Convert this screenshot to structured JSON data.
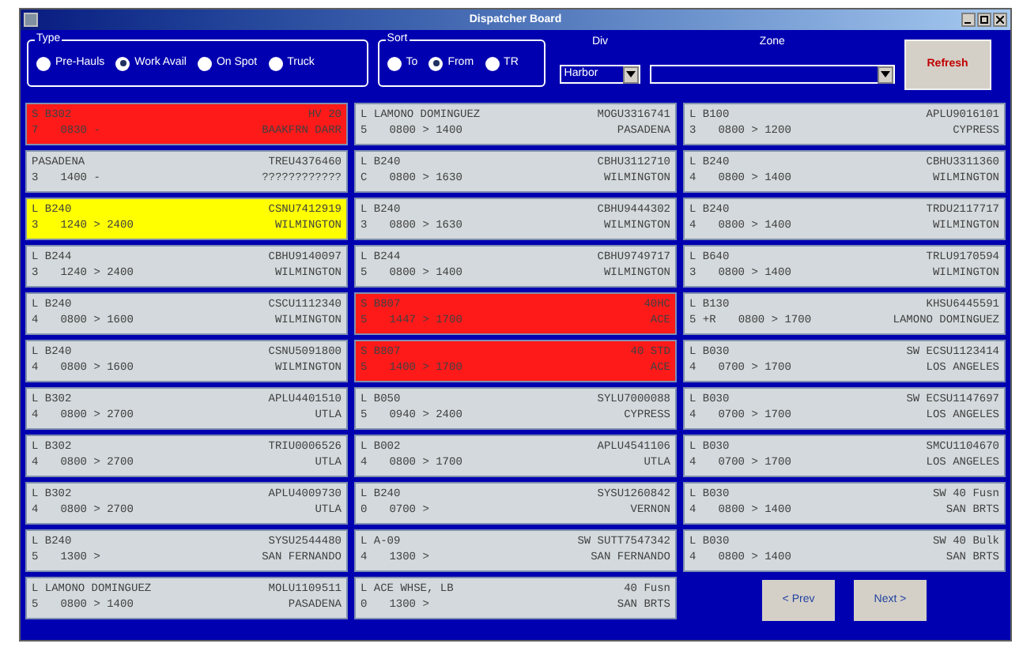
{
  "window": {
    "title": "Dispatcher Board"
  },
  "type_group": {
    "legend": "Type",
    "options": [
      {
        "label": "Pre-Hauls",
        "selected": false
      },
      {
        "label": "Work Avail",
        "selected": true
      },
      {
        "label": "On Spot",
        "selected": false
      },
      {
        "label": "Truck",
        "selected": false
      }
    ]
  },
  "sort_group": {
    "legend": "Sort",
    "options": [
      {
        "label": "To",
        "selected": false
      },
      {
        "label": "From",
        "selected": true
      },
      {
        "label": "TR",
        "selected": false
      }
    ]
  },
  "div": {
    "label": "Div",
    "value": "Harbor"
  },
  "zone": {
    "label": "Zone"
  },
  "refresh_button": "Refresh",
  "columns": [
    {
      "cards": [
        {
          "color": "#ff1a1a",
          "yard": "S B302",
          "container": "HV 20",
          "slot": "7",
          "window": "0830 -",
          "location": "BAAKFRN DARR"
        },
        {
          "color": "#d3d9dc",
          "yard": "PASADENA",
          "container": "TREU4376460",
          "slot": "3",
          "window": "1400 -",
          "location": "????????????"
        },
        {
          "color": "#ffff00",
          "yard": "L B240",
          "container": "CSNU7412919",
          "slot": "3",
          "window": "1240 > 2400",
          "location": "WILMINGTON"
        },
        {
          "color": "#d3d9dc",
          "yard": "L B244",
          "container": "CBHU9140097",
          "slot": "3",
          "window": "1240 > 2400",
          "location": "WILMINGTON"
        },
        {
          "color": "#d3d9dc",
          "yard": "L B240",
          "container": "CSCU1112340",
          "slot": "4",
          "window": "0800 > 1600",
          "location": "WILMINGTON"
        },
        {
          "color": "#d3d9dc",
          "yard": "L B240",
          "container": "CSNU5091800",
          "slot": "4",
          "window": "0800 > 1600",
          "location": "WILMINGTON"
        },
        {
          "color": "#d3d9dc",
          "yard": "L B302",
          "container": "APLU4401510",
          "slot": "4",
          "window": "0800 > 2700",
          "location": "UTLA"
        },
        {
          "color": "#d3d9dc",
          "yard": "L B302",
          "container": "TRIU0006526",
          "slot": "4",
          "window": "0800 > 2700",
          "location": "UTLA"
        },
        {
          "color": "#d3d9dc",
          "yard": "L B302",
          "container": "APLU4009730",
          "slot": "4",
          "window": "0800 > 2700",
          "location": "UTLA"
        },
        {
          "color": "#d3d9dc",
          "yard": "L B240",
          "container": "SYSU2544480",
          "slot": "5",
          "window": "1300 >",
          "location": "SAN FERNANDO"
        },
        {
          "color": "#d3d9dc",
          "yard": "L LAMONO DOMINGUEZ",
          "container": "MOLU1109511",
          "slot": "5",
          "window": "0800 > 1400",
          "location": "PASADENA"
        }
      ]
    },
    {
      "cards": [
        {
          "color": "#d3d9dc",
          "yard": "L LAMONO DOMINGUEZ",
          "container": "MOGU3316741",
          "slot": "5",
          "window": "0800 > 1400",
          "location": "PASADENA"
        },
        {
          "color": "#d3d9dc",
          "yard": "L B240",
          "container": "CBHU3112710",
          "slot": "C",
          "window": "0800 > 1630",
          "location": "WILMINGTON"
        },
        {
          "color": "#d3d9dc",
          "yard": "L B240",
          "container": "CBHU9444302",
          "slot": "3",
          "window": "0800 > 1630",
          "location": "WILMINGTON"
        },
        {
          "color": "#d3d9dc",
          "yard": "L B244",
          "container": "CBHU9749717",
          "slot": "5",
          "window": "0800 > 1400",
          "location": "WILMINGTON"
        },
        {
          "color": "#ff1a1a",
          "yard": "S B807",
          "container": "40HC",
          "slot": "5",
          "window": "1447 > 1700",
          "location": "ACE"
        },
        {
          "color": "#ff1a1a",
          "yard": "S B807",
          "container": "40 STD",
          "slot": "5",
          "window": "1400 > 1700",
          "location": "ACE"
        },
        {
          "color": "#d3d9dc",
          "yard": "L B050",
          "container": "SYLU7000088",
          "slot": "5",
          "window": "0940 > 2400",
          "location": "CYPRESS"
        },
        {
          "color": "#d3d9dc",
          "yard": "L B002",
          "container": "APLU4541106",
          "slot": "4",
          "window": "0800 > 1700",
          "location": "UTLA"
        },
        {
          "color": "#d3d9dc",
          "yard": "L B240",
          "container": "SYSU1260842",
          "slot": "0",
          "window": "0700 >",
          "location": "VERNON"
        },
        {
          "color": "#d3d9dc",
          "yard": "L A-09",
          "container": "SW SUTT7547342",
          "slot": "4",
          "window": "1300 >",
          "location": "SAN FERNANDO"
        },
        {
          "color": "#d3d9dc",
          "yard": "L ACE WHSE, LB",
          "container": "40 Fusn",
          "slot": "0",
          "window": "1300 >",
          "location": "SAN BRTS"
        }
      ]
    },
    {
      "cards": [
        {
          "color": "#d3d9dc",
          "yard": "L B100",
          "container": "APLU9016101",
          "slot": "3",
          "window": "0800 > 1200",
          "location": "CYPRESS"
        },
        {
          "color": "#d3d9dc",
          "yard": "L B240",
          "container": "CBHU3311360",
          "slot": "4",
          "window": "0800 > 1400",
          "location": "WILMINGTON"
        },
        {
          "color": "#d3d9dc",
          "yard": "L B240",
          "container": "TRDU2117717",
          "slot": "4",
          "window": "0800 > 1400",
          "location": "WILMINGTON"
        },
        {
          "color": "#d3d9dc",
          "yard": "L B640",
          "container": "TRLU9170594",
          "slot": "3",
          "window": "0800 > 1400",
          "location": "WILMINGTON"
        },
        {
          "color": "#d3d9dc",
          "yard": "L B130",
          "container": "KHSU6445591",
          "slot": "5 +R",
          "window": "0800 > 1700",
          "location": "LAMONO DOMINGUEZ"
        },
        {
          "color": "#d3d9dc",
          "yard": "L B030",
          "container": "SW ECSU1123414",
          "slot": "4",
          "window": "0700 > 1700",
          "location": "LOS ANGELES"
        },
        {
          "color": "#d3d9dc",
          "yard": "L B030",
          "container": "SW ECSU1147697",
          "slot": "4",
          "window": "0700 > 1700",
          "location": "LOS ANGELES"
        },
        {
          "color": "#d3d9dc",
          "yard": "L B030",
          "container": "SMCU1104670",
          "slot": "4",
          "window": "0700 > 1700",
          "location": "LOS ANGELES"
        },
        {
          "color": "#d3d9dc",
          "yard": "L B030",
          "container": "SW 40 Fusn",
          "slot": "4",
          "window": "0800 > 1400",
          "location": "SAN BRTS"
        },
        {
          "color": "#d3d9dc",
          "yard": "L B030",
          "container": "SW 40 Bulk",
          "slot": "4",
          "window": "0800 > 1400",
          "location": "SAN BRTS"
        }
      ]
    }
  ],
  "pager": {
    "prev": "< Prev",
    "next": "Next >"
  }
}
